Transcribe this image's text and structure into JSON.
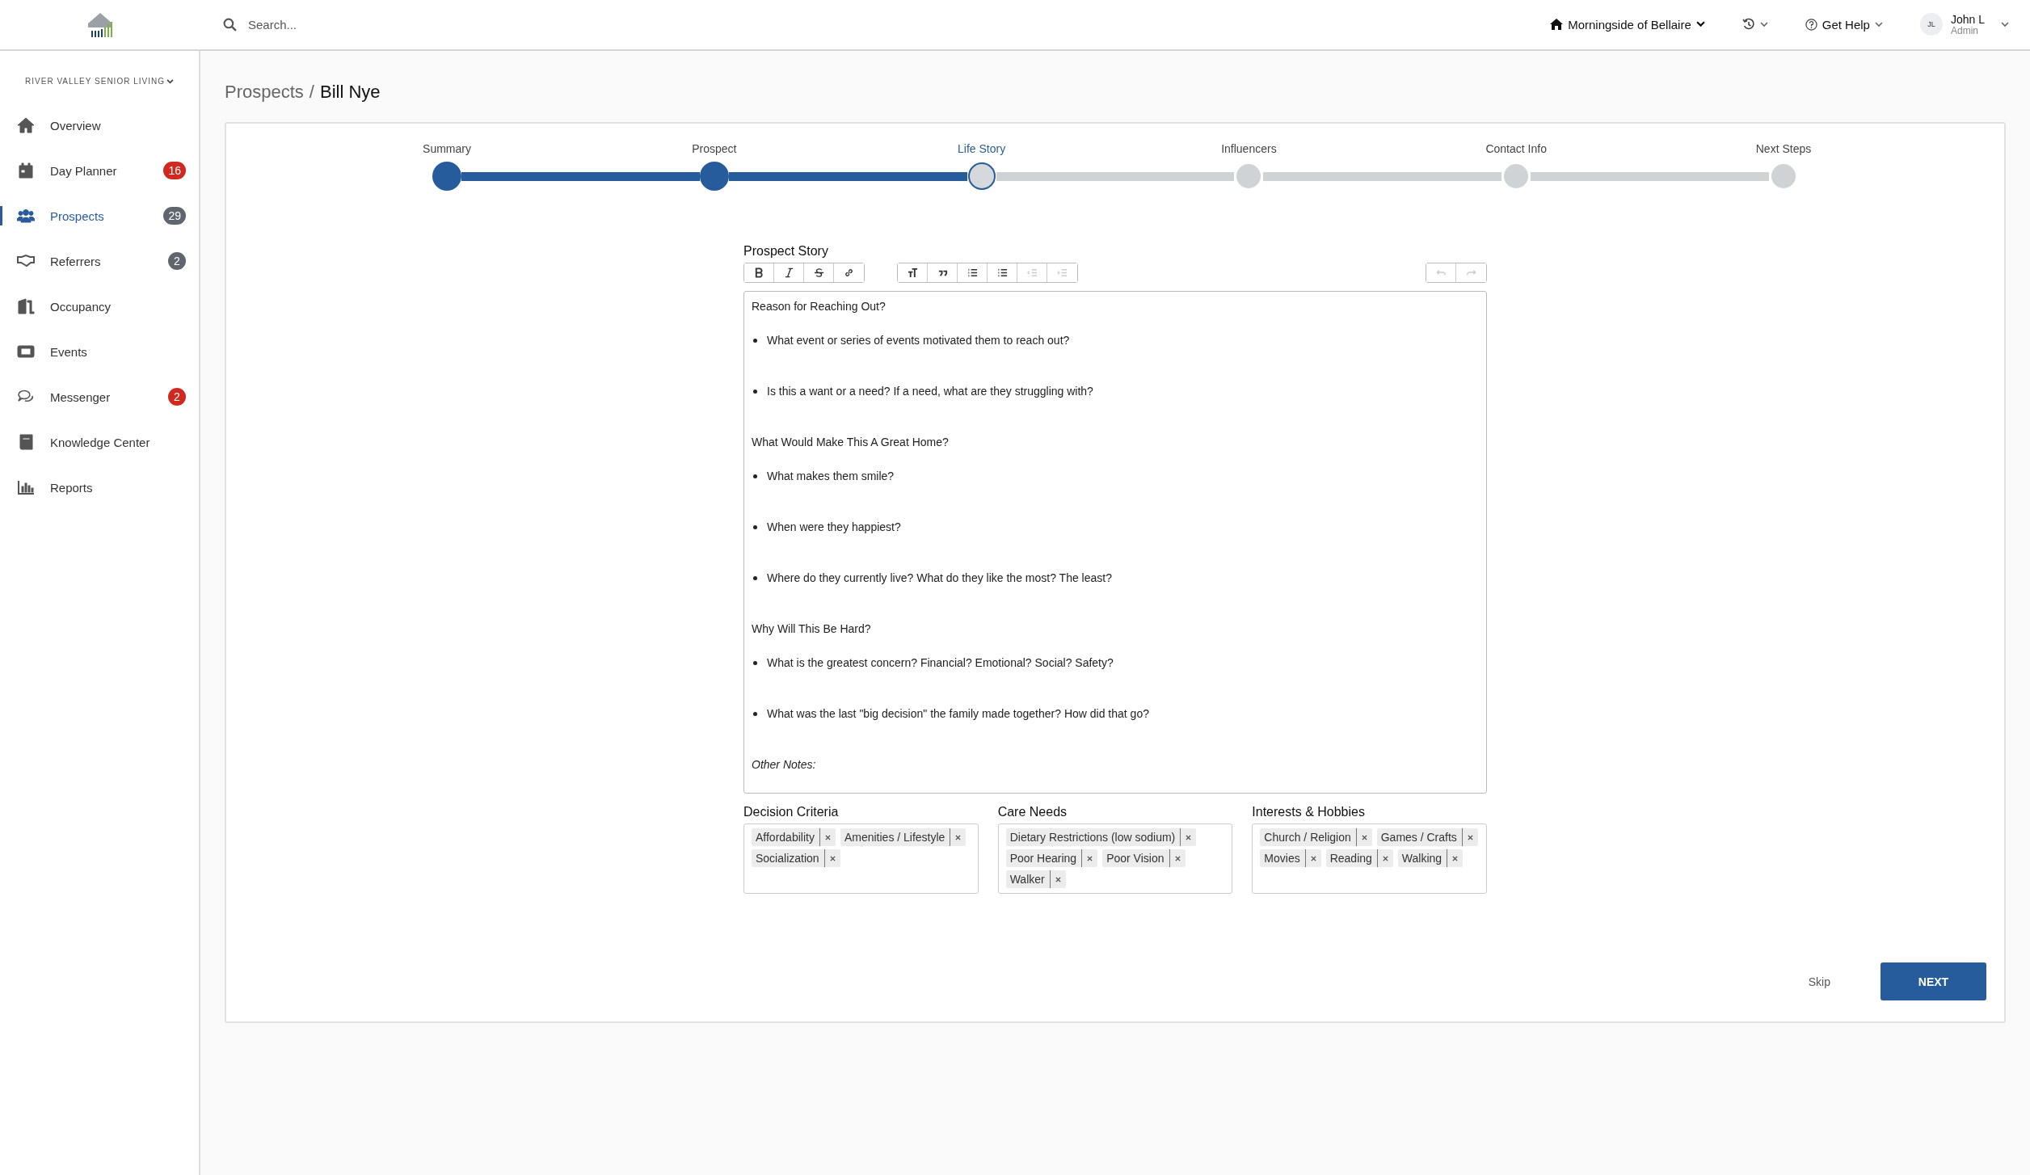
{
  "topbar": {
    "search": {
      "placeholder": "Search..."
    },
    "community": "Morningside of Bellaire",
    "help": "Get Help",
    "user": {
      "initials": "JL",
      "name": "John L",
      "role": "Admin"
    }
  },
  "sidebar": {
    "organization": "RIVER VALLEY SENIOR LIVING",
    "items": [
      {
        "label": "Overview",
        "selected": false
      },
      {
        "label": "Day Planner",
        "selected": false,
        "badge": "16",
        "color": "#d0291f"
      },
      {
        "label": "Prospects",
        "selected": true,
        "badge": "29",
        "color": "#5f666d"
      },
      {
        "label": "Referrers",
        "selected": false,
        "badge": "2",
        "color": "#5f666d"
      },
      {
        "label": "Occupancy",
        "selected": false
      },
      {
        "label": "Events",
        "selected": false
      },
      {
        "label": "Messenger",
        "selected": false,
        "badge": "2",
        "color": "#d0291f"
      },
      {
        "label": "Knowledge Center",
        "selected": false
      },
      {
        "label": "Reports",
        "selected": false
      }
    ]
  },
  "breadcrumb": {
    "parent": "Prospects",
    "separator": "/",
    "current": "Bill Nye"
  },
  "steps": [
    {
      "label": "Summary",
      "done": true,
      "selected": false
    },
    {
      "label": "Prospect",
      "done": true,
      "selected": false
    },
    {
      "label": "Life Story",
      "done": false,
      "selected": true
    },
    {
      "label": "Influencers",
      "done": false,
      "selected": false
    },
    {
      "label": "Contact Info",
      "done": false,
      "selected": false
    },
    {
      "label": "Next Steps",
      "done": false,
      "selected": false
    }
  ],
  "editor": {
    "label": "Prospect Story",
    "toolbar": [
      [
        {
          "kind": "bold",
          "disabled": false
        },
        {
          "kind": "italic",
          "disabled": false
        },
        {
          "kind": "strike",
          "disabled": false
        },
        {
          "kind": "link",
          "disabled": false
        }
      ],
      [
        {
          "kind": "heading",
          "disabled": false
        },
        {
          "kind": "quote",
          "disabled": false
        },
        {
          "kind": "bullets",
          "disabled": false
        },
        {
          "kind": "numbers",
          "disabled": false
        },
        {
          "kind": "outdent",
          "disabled": true
        },
        {
          "kind": "indent",
          "disabled": true
        }
      ],
      [
        {
          "kind": "undo",
          "disabled": true
        },
        {
          "kind": "redo",
          "disabled": true
        }
      ]
    ],
    "blocks": [
      {
        "kind": "heading",
        "text": "Reason for Reaching Out?"
      },
      {
        "kind": "bullet",
        "text": "What event or series of events motivated them to reach out?"
      },
      {
        "kind": "bullet",
        "text": "Is this a want or a need?  If a need, what are they struggling with?"
      },
      {
        "kind": "heading",
        "text": "What Would Make This A Great Home?"
      },
      {
        "kind": "bullet",
        "text": "What makes them smile?"
      },
      {
        "kind": "bullet",
        "text": "When were they happiest?"
      },
      {
        "kind": "bullet",
        "text": "Where do they currently live?  What do they like the most?  The least?"
      },
      {
        "kind": "heading",
        "text": "Why Will This Be Hard?"
      },
      {
        "kind": "bullet",
        "text": "What is the greatest concern?  Financial?  Emotional?  Social?  Safety?"
      },
      {
        "kind": "bullet",
        "text": "What was the last \"big decision\" the family made together?  How did that go?"
      },
      {
        "kind": "note",
        "text": "Other Notes:"
      }
    ]
  },
  "tag_groups": [
    {
      "label": "Decision Criteria",
      "tags": [
        "Affordability",
        "Amenities / Lifestyle",
        "Socialization"
      ]
    },
    {
      "label": "Care Needs",
      "tags": [
        "Dietary Restrictions (low sodium)",
        "Poor Hearing",
        "Poor Vision",
        "Walker"
      ]
    },
    {
      "label": "Interests & Hobbies",
      "tags": [
        "Church / Religion",
        "Games / Crafts",
        "Movies",
        "Reading",
        "Walking"
      ]
    }
  ],
  "actions": {
    "skip": "Skip",
    "next": "NEXT"
  }
}
